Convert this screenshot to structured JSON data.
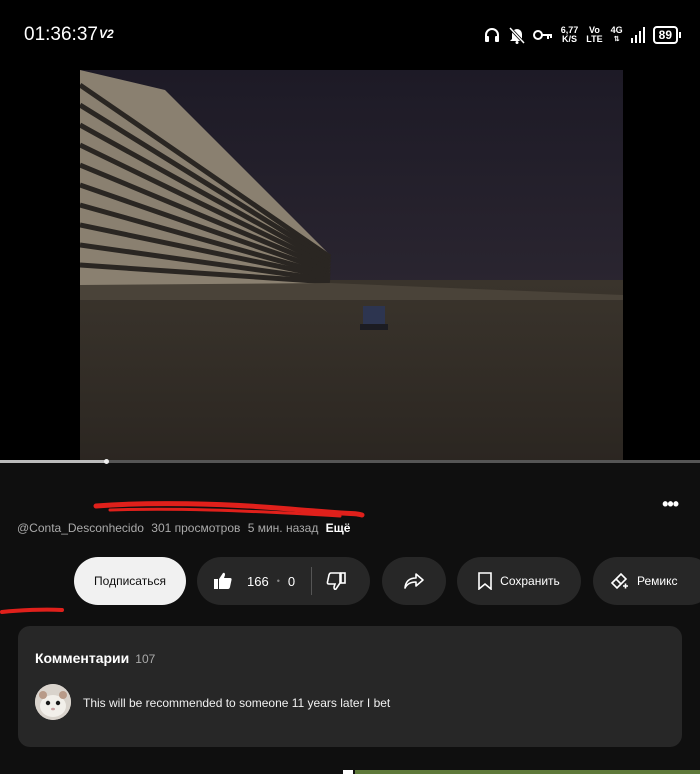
{
  "status_bar": {
    "time": "01:36:37",
    "carrier_tag": "V2",
    "net_speed_value": "6,77",
    "net_speed_unit": "K/S",
    "volte_top": "Vo",
    "volte_bottom": "LTE",
    "network": "4G",
    "battery": "89",
    "icons": [
      "headphones-icon",
      "bell-muted-icon",
      "key-icon",
      "signal-icon"
    ]
  },
  "video": {
    "progress": 0.15
  },
  "meta": {
    "channel": "@Conta_Desconhecido",
    "views": "301 просмотров",
    "age": "5 мин. назад",
    "more": "Ещё"
  },
  "actions": {
    "subscribe": "Подписаться",
    "likes": "166",
    "dislikes": "0",
    "save": "Сохранить",
    "remix": "Ремикс"
  },
  "comments": {
    "title": "Комментарии",
    "count": "107",
    "top_comment": "This will be recommended to someone 11 years later I bet"
  },
  "colors": {
    "background": "#0f0f0f",
    "pill": "#272727",
    "scribble": "#e0201b"
  }
}
